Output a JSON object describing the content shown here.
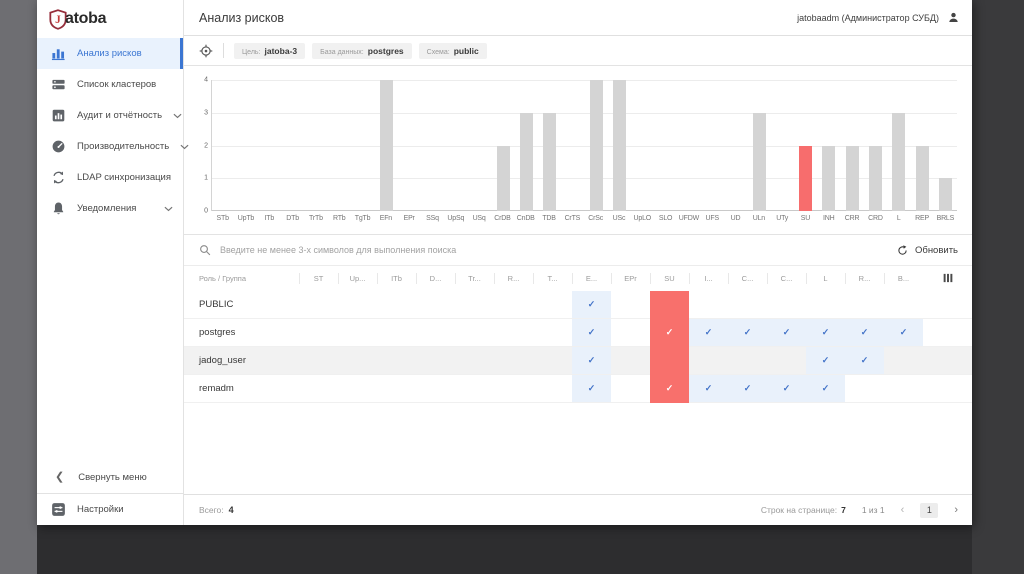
{
  "app": {
    "logo_letter": "J",
    "logo_rest": "atoba",
    "user_label": "jatobaadm  (Администратор СУБД)"
  },
  "header": {
    "title": "Анализ рисков"
  },
  "sidebar": {
    "items": [
      {
        "label": "Анализ рисков",
        "icon": "bar-chart-icon",
        "active": true,
        "expandable": false
      },
      {
        "label": "Список кластеров",
        "icon": "clusters-icon",
        "active": false,
        "expandable": false
      },
      {
        "label": "Аудит и отчётность",
        "icon": "audit-icon",
        "active": false,
        "expandable": true
      },
      {
        "label": "Производительность",
        "icon": "performance-icon",
        "active": false,
        "expandable": true
      },
      {
        "label": "LDAP синхронизация",
        "icon": "ldap-sync-icon",
        "active": false,
        "expandable": false
      },
      {
        "label": "Уведомления",
        "icon": "bell-icon",
        "active": false,
        "expandable": true
      }
    ],
    "collapse_label": "Свернуть меню",
    "settings_label": "Настройки"
  },
  "toolbar": {
    "chips": [
      {
        "label": "Цель:",
        "value": "jatoba-3"
      },
      {
        "label": "База данных:",
        "value": "postgres"
      },
      {
        "label": "Схема:",
        "value": "public"
      }
    ]
  },
  "chart_data": {
    "type": "bar",
    "categories": [
      "STb",
      "UpTb",
      "ITb",
      "DTb",
      "TrTb",
      "RTb",
      "TgTb",
      "EFn",
      "EPr",
      "SSq",
      "UpSq",
      "USq",
      "CrDB",
      "CnDB",
      "TDB",
      "CrTS",
      "CrSc",
      "USc",
      "UpLO",
      "SLO",
      "UFDW",
      "UFS",
      "UD",
      "ULn",
      "UTy",
      "SU",
      "INH",
      "CRR",
      "CRD",
      "L",
      "REP",
      "BRLS"
    ],
    "values": [
      0,
      0,
      0,
      0,
      0,
      0,
      0,
      4,
      0,
      0,
      0,
      0,
      2,
      3,
      3,
      0,
      4,
      4,
      0,
      0,
      0,
      0,
      0,
      3,
      0,
      2,
      2,
      2,
      2,
      3,
      2,
      1
    ],
    "title": "",
    "xlabel": "",
    "ylabel": "",
    "ylim": [
      0,
      4
    ],
    "yticks": [
      0,
      1,
      2,
      3,
      4
    ],
    "grid": true,
    "legend": false,
    "bar_color": "#d4d4d4",
    "highlight_category": "SU",
    "highlight_color": "#f76d6d"
  },
  "table": {
    "search_placeholder": "Введите не менее 3-х символов для выполнения поиска",
    "refresh_label": "Обновить",
    "role_column_header": "Роль / Группа",
    "permission_columns": [
      "ST",
      "Up...",
      "ITb",
      "D...",
      "Tr...",
      "R...",
      "T...",
      "E...",
      "EPr",
      "SU",
      "I...",
      "C...",
      "C...",
      "L",
      "R...",
      "B..."
    ],
    "blue_column_index": 7,
    "red_column_index": 9,
    "blue_column_color": "#e9f1fb",
    "red_column_color": "#f8706c",
    "shaded_row_color": "#f2f2f2",
    "rows": [
      {
        "name": "PUBLIC",
        "checks": [
          7
        ],
        "shaded": false
      },
      {
        "name": "postgres",
        "checks": [
          7,
          9,
          10,
          11,
          12,
          13,
          14,
          15
        ],
        "shaded": false
      },
      {
        "name": "jadog_user",
        "checks": [
          7,
          13,
          14
        ],
        "shaded": true
      },
      {
        "name": "remadm",
        "checks": [
          7,
          9,
          10,
          11,
          12,
          13
        ],
        "shaded": false
      }
    ]
  },
  "footer": {
    "total_label": "Всего:",
    "total_value": "4",
    "rows_per_page_label": "Строк на странице:",
    "rows_per_page_value": "7",
    "page_info": "1 из 1",
    "current_page": "1"
  },
  "colors": {
    "accent_blue": "#3b76d2",
    "check_blue": "#4273c8",
    "highlight_red": "#f8706c",
    "logo_red": "#c43b3b"
  }
}
